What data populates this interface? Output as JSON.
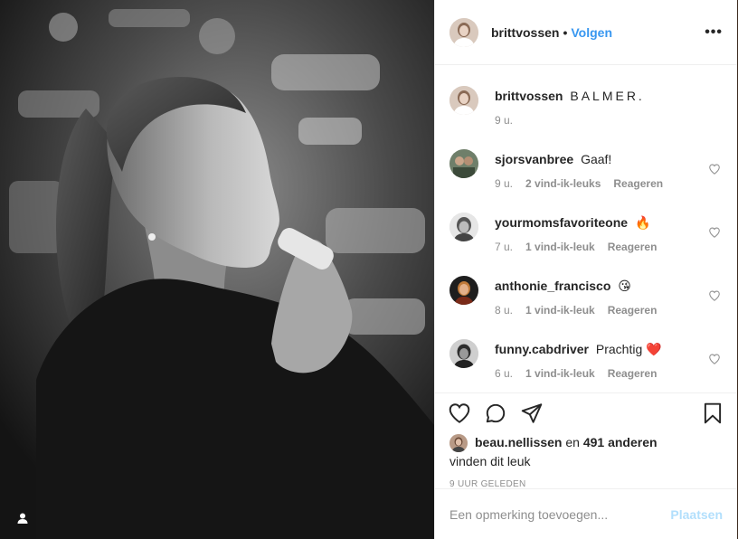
{
  "post": {
    "author": "brittvossen",
    "separator": "•",
    "follow_label": "Volgen",
    "more_label": "•••"
  },
  "caption": {
    "user": "brittvossen",
    "text": "BALMER.",
    "time": "9 u."
  },
  "comments": [
    {
      "user": "sjorsvanbree",
      "text": "Gaaf!",
      "time": "9 u.",
      "likes": "2 vind-ik-leuks",
      "reply": "Reageren"
    },
    {
      "user": "yourmomsfavoriteone",
      "text": "🔥",
      "time": "7 u.",
      "likes": "1 vind-ik-leuk",
      "reply": "Reageren"
    },
    {
      "user": "anthonie_francisco",
      "text": "😘",
      "time": "8 u.",
      "likes": "1 vind-ik-leuk",
      "reply": "Reageren"
    },
    {
      "user": "funny.cabdriver",
      "text": "Prachtig ❤️",
      "time": "6 u.",
      "likes": "1 vind-ik-leuk",
      "reply": "Reageren"
    }
  ],
  "likes": {
    "user": "beau.nellissen",
    "joiner": "en",
    "others": "491 anderen",
    "suffix": "vinden dit leuk"
  },
  "timestamp": "9 UUR GELEDEN",
  "add_comment": {
    "placeholder": "Een opmerking toevoegen...",
    "post_label": "Plaatsen"
  },
  "icons": {
    "tag": "user-tag-icon",
    "like": "heart-icon",
    "comment": "comment-bubble-icon",
    "share": "paper-plane-icon",
    "save": "bookmark-icon",
    "comment_like": "heart-outline-icon"
  },
  "colors": {
    "follow": "#3897f0",
    "post_disabled": "#b2dffc",
    "meta": "#8e8e8e",
    "text": "#262626"
  }
}
